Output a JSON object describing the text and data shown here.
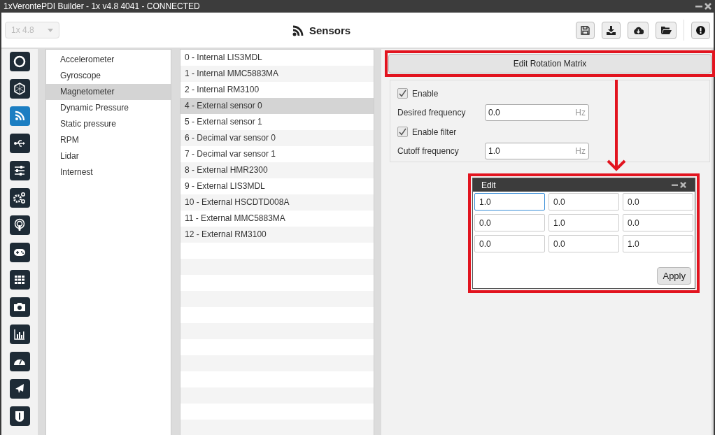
{
  "window": {
    "title": "1xVerontePDI Builder - 1x v4.8 4041 - CONNECTED"
  },
  "version_select": {
    "value": "1x 4.8",
    "disabled": true
  },
  "page_title": "Sensors",
  "nav_rail": [
    {
      "selected": false
    },
    {
      "selected": false
    },
    {
      "selected": true
    },
    {
      "selected": false
    },
    {
      "selected": false
    },
    {
      "selected": false
    },
    {
      "selected": false
    },
    {
      "selected": false
    },
    {
      "selected": false
    },
    {
      "selected": false
    },
    {
      "selected": false
    },
    {
      "selected": false
    },
    {
      "selected": false
    },
    {
      "selected": false
    }
  ],
  "categories": [
    {
      "label": "Accelerometer",
      "selected": false
    },
    {
      "label": "Gyroscope",
      "selected": false
    },
    {
      "label": "Magnetometer",
      "selected": true
    },
    {
      "label": "Dynamic Pressure",
      "selected": false
    },
    {
      "label": "Static pressure",
      "selected": false
    },
    {
      "label": "RPM",
      "selected": false
    },
    {
      "label": "Lidar",
      "selected": false
    },
    {
      "label": "Internest",
      "selected": false
    }
  ],
  "sensors": [
    {
      "label": "0 - Internal LIS3MDL",
      "selected": false
    },
    {
      "label": "1 - Internal MMC5883MA",
      "selected": false
    },
    {
      "label": "2 - Internal RM3100",
      "selected": false
    },
    {
      "label": "4 - External sensor 0",
      "selected": true
    },
    {
      "label": "5 - External sensor 1",
      "selected": false
    },
    {
      "label": "6 - Decimal var sensor 0",
      "selected": false
    },
    {
      "label": "7 - Decimal var sensor 1",
      "selected": false
    },
    {
      "label": "8 - External HMR2300",
      "selected": false
    },
    {
      "label": "9 - External LIS3MDL",
      "selected": false
    },
    {
      "label": "10 - External HSCDTD008A",
      "selected": false
    },
    {
      "label": "11 - External MMC5883MA",
      "selected": false
    },
    {
      "label": "12 - External RM3100",
      "selected": false
    }
  ],
  "edit_button": "Edit Rotation Matrix",
  "settings": [
    {
      "kind": "checkbox",
      "label": "Enable",
      "checked": true
    },
    {
      "kind": "field",
      "label": "Desired frequency",
      "value": "0.0",
      "unit": "Hz"
    },
    {
      "kind": "checkbox",
      "label": "Enable filter",
      "checked": true
    },
    {
      "kind": "field",
      "label": "Cutoff frequency",
      "value": "1.0",
      "unit": "Hz"
    }
  ],
  "dialog": {
    "title": "Edit",
    "matrix": [
      [
        "1.0",
        "0.0",
        "0.0"
      ],
      [
        "0.0",
        "1.0",
        "0.0"
      ],
      [
        "0.0",
        "0.0",
        "1.0"
      ]
    ],
    "apply": "Apply"
  }
}
